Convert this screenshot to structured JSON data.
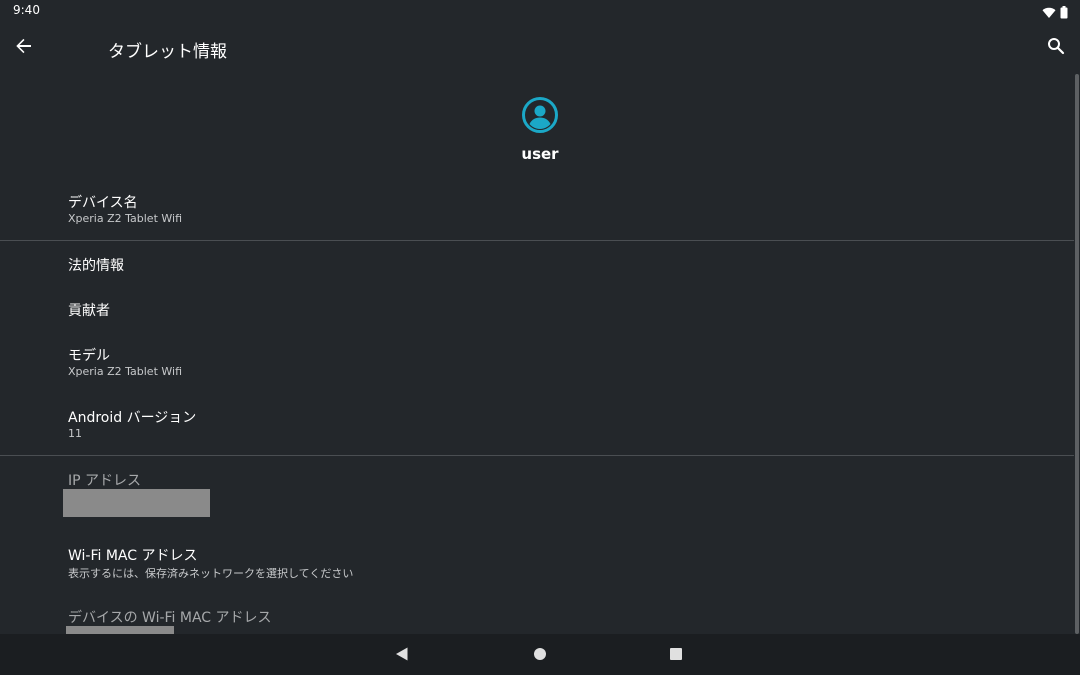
{
  "status_bar": {
    "time": "9:40",
    "icons": [
      "wifi-icon",
      "battery-icon"
    ]
  },
  "app_bar": {
    "title": "タブレット情報",
    "back_icon": "arrow-back-icon",
    "search_icon": "search-icon"
  },
  "user": {
    "avatar_icon": "account-circle-icon",
    "name": "user",
    "accent_color": "#1ba8c7"
  },
  "settings": [
    {
      "title": "デバイス名",
      "summary": "Xperia Z2 Tablet Wifi"
    },
    {
      "title": "法的情報"
    },
    {
      "title": "貢献者"
    },
    {
      "title": "モデル",
      "summary": "Xperia Z2 Tablet Wifi"
    },
    {
      "title": "Android バージョン",
      "summary": "11"
    },
    {
      "title": "IP アドレス",
      "summary_redacted": true
    },
    {
      "title": "Wi-Fi MAC アドレス",
      "summary": "表示するには、保存済みネットワークを選択してください"
    },
    {
      "title": "デバイスの Wi-Fi MAC アドレス",
      "summary_redacted": true
    }
  ],
  "nav_bar": {
    "buttons": [
      "back-triangle-icon",
      "home-circle-icon",
      "recents-square-icon"
    ]
  },
  "colors": {
    "background": "#23272b",
    "nav_background": "#1b1e21",
    "divider": "#4a4e52",
    "redaction": "#8a8a8a"
  }
}
